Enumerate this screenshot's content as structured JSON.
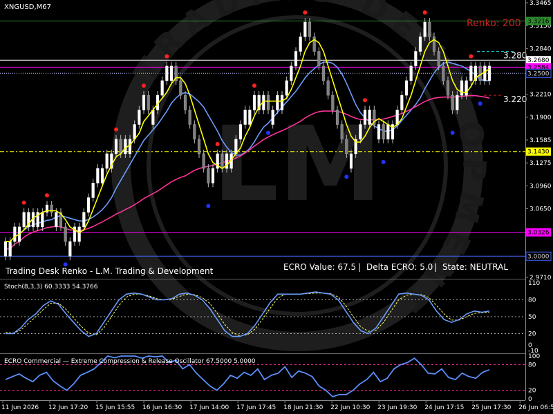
{
  "symbol_label": "XNGUSD,M67",
  "renko_label": "Renko: 200",
  "bottom_caption": "Trading Desk Renko - L.M. Trading & Development",
  "status": {
    "ecro_value": "ECRO Value: 67.5",
    "delta_ecro": "Delta ECRO: 5.0",
    "state": "State: NEUTRAL",
    "separator": "|"
  },
  "watermark": {
    "letters": "LM",
    "ring_text": "TRADING DEVELOPMENT"
  },
  "price_axis": {
    "ticks": [
      "3.3465",
      "3.3150",
      "3.2840",
      "3.2530",
      "3.2210",
      "3.1900",
      "3.1585",
      "3.1275",
      "3.0960",
      "3.0650",
      "3.0335",
      "3.0025",
      "2.9710"
    ],
    "badges": [
      {
        "text": "3.3216",
        "color": "#2e8b2e",
        "value": 3.3216
      },
      {
        "text": "3.2680",
        "color": "#ffffff",
        "value": 3.268
      },
      {
        "text": "3.2584",
        "color": "#ff00ff",
        "value": 3.2584
      },
      {
        "text": "3.2500",
        "color": "#000000",
        "value": 3.25
      },
      {
        "text": "3.1430",
        "color": "#ffff00",
        "value": 3.143
      },
      {
        "text": "3.0326",
        "color": "#ff00ff",
        "value": 3.0326
      },
      {
        "text": "3.0000",
        "color": "#000000",
        "value": 3.0
      }
    ],
    "level_labels": [
      {
        "text": "3.280",
        "value": 3.28
      },
      {
        "text": "3.220",
        "value": 3.22
      }
    ]
  },
  "stoch": {
    "title": "Stoch(8,3,3) 60.3333 54.3766",
    "ticks": [
      "110",
      "80",
      "50",
      "20",
      "0",
      "-10"
    ]
  },
  "ecro": {
    "title": "ECRO Commercial — Extreme Compression & Release Oscillator 67.5000 5.0000",
    "ticks": [
      "100",
      "80",
      "20",
      "0"
    ]
  },
  "time_axis": [
    "11 Jun 2026",
    "12 Jun 17:20",
    "15 Jun 15:55",
    "16 Jun 16:30",
    "17 Jun 14:00",
    "17 Jun 17:45",
    "18 Jun 21:30",
    "22 Jun 10:30",
    "23 Jun 19:30",
    "24 Jun 17:15",
    "25 Jun 17:30",
    "26 Jun 06:50"
  ],
  "chart_data": {
    "type": "renko",
    "price_range": [
      2.971,
      3.3465
    ],
    "series": [
      {
        "name": "price",
        "values": [
          3.02,
          3.02,
          3.04,
          3.04,
          3.06,
          3.06,
          3.06,
          3.06,
          3.06,
          3.07,
          3.06,
          3.06,
          3.04,
          3.02,
          3.02,
          3.04,
          3.04,
          3.06,
          3.08,
          3.1,
          3.12,
          3.12,
          3.14,
          3.14,
          3.16,
          3.14,
          3.16,
          3.16,
          3.18,
          3.2,
          3.22,
          3.2,
          3.2,
          3.22,
          3.24,
          3.26,
          3.26,
          3.24,
          3.22,
          3.2,
          3.18,
          3.16,
          3.14,
          3.12,
          3.1,
          3.12,
          3.14,
          3.12,
          3.14,
          3.14,
          3.16,
          3.18,
          3.2,
          3.2,
          3.22,
          3.22,
          3.22,
          3.2,
          3.2,
          3.22,
          3.22,
          3.24,
          3.26,
          3.28,
          3.3,
          3.32,
          3.3,
          3.28,
          3.26,
          3.24,
          3.22,
          3.2,
          3.18,
          3.16,
          3.14,
          3.14,
          3.16,
          3.18,
          3.2,
          3.2,
          3.18,
          3.18,
          3.16,
          3.18,
          3.18,
          3.2,
          3.22,
          3.24,
          3.26,
          3.28,
          3.3,
          3.32,
          3.3,
          3.28,
          3.26,
          3.24,
          3.22,
          3.2,
          3.22,
          3.24,
          3.24,
          3.26,
          3.26,
          3.24,
          3.26,
          3.26
        ]
      }
    ],
    "levels": [
      3.3216,
      3.268,
      3.2584,
      3.25,
      3.143,
      3.0326,
      3.0
    ],
    "stoch_range": [
      -10,
      110
    ],
    "stoch_levels": [
      80,
      50,
      20
    ],
    "stoch_k": [
      20,
      20,
      30,
      45,
      55,
      70,
      78,
      72,
      55,
      40,
      25,
      15,
      20,
      40,
      60,
      80,
      90,
      92,
      90,
      85,
      80,
      80,
      82,
      90,
      92,
      88,
      80,
      65,
      45,
      25,
      15,
      15,
      20,
      35,
      55,
      75,
      90,
      90,
      90,
      90,
      92,
      94,
      92,
      90,
      80,
      60,
      40,
      25,
      20,
      30,
      50,
      70,
      90,
      92,
      90,
      88,
      80,
      60,
      45,
      40,
      45,
      55,
      60,
      58,
      60
    ],
    "stoch_d": [
      22,
      21,
      26,
      38,
      50,
      63,
      74,
      74,
      63,
      48,
      33,
      21,
      18,
      30,
      50,
      70,
      85,
      90,
      90,
      87,
      82,
      80,
      81,
      86,
      90,
      89,
      84,
      74,
      56,
      36,
      22,
      16,
      18,
      28,
      46,
      65,
      83,
      90,
      90,
      90,
      91,
      92,
      92,
      91,
      85,
      70,
      50,
      32,
      24,
      26,
      40,
      60,
      80,
      88,
      90,
      89,
      84,
      70,
      55,
      44,
      44,
      50,
      56,
      57,
      58
    ],
    "ecro_range": [
      0,
      100
    ],
    "ecro_levels": [
      80,
      20
    ],
    "ecro": [
      45,
      52,
      58,
      48,
      40,
      55,
      62,
      42,
      30,
      20,
      35,
      55,
      62,
      70,
      85,
      100,
      96,
      100,
      100,
      100,
      95,
      100,
      98,
      100,
      85,
      90,
      70,
      80,
      60,
      45,
      30,
      20,
      35,
      55,
      48,
      62,
      55,
      70,
      45,
      55,
      60,
      75,
      50,
      65,
      60,
      52,
      30,
      20,
      5,
      10,
      10,
      20,
      35,
      45,
      62,
      40,
      48,
      70,
      80,
      85,
      95,
      80,
      60,
      58,
      70,
      50,
      45,
      60,
      52,
      48,
      62,
      68
    ]
  }
}
